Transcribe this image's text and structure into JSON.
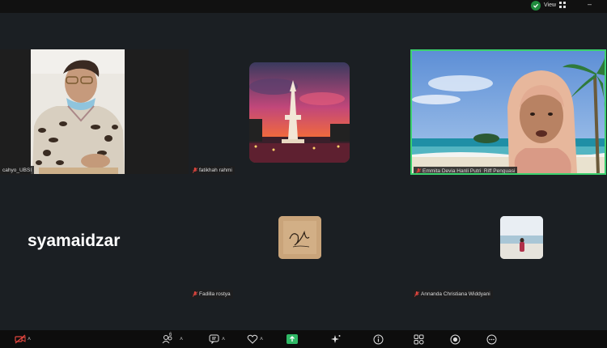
{
  "topbar": {
    "view_label": "View"
  },
  "participants": [
    {
      "name": "cahyo_UBSI",
      "muted": false
    },
    {
      "name": "fatikhah rahmi",
      "muted": true
    },
    {
      "name": "Emmita Devia Hanli Putri_Riff Penguasi",
      "muted": true
    },
    {
      "name": "syamaidzar",
      "muted": false
    },
    {
      "name": "Fadilla rostya",
      "muted": true
    },
    {
      "name": "Annanda Christiana Widdyani",
      "muted": true
    }
  ],
  "toolbar": {
    "participants_count": "6"
  },
  "colors": {
    "active_speaker": "#3bd16f",
    "mute": "#e0453e",
    "share": "#2fb865"
  }
}
